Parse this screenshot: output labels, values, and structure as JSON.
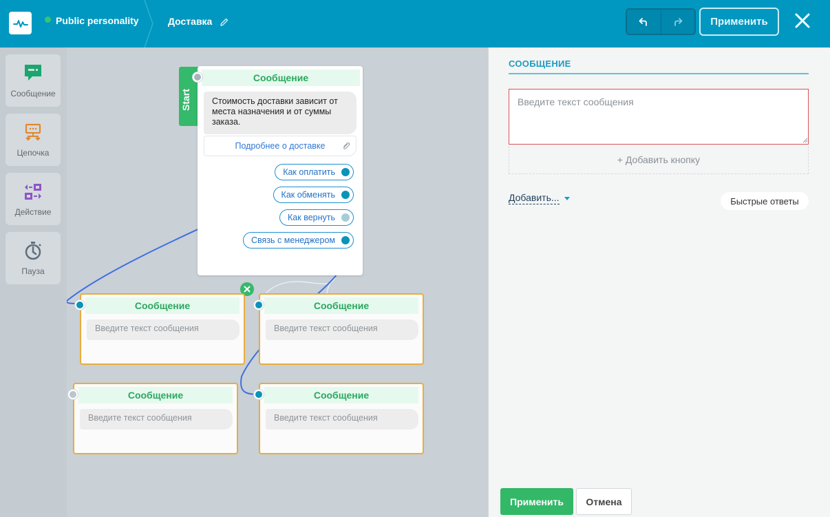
{
  "header": {
    "bot_name": "Public personality",
    "page_name": "Доставка",
    "apply_label": "Применить",
    "icons": {
      "logo": "pulse-logo-icon",
      "edit": "pencil-icon",
      "undo": "undo-icon",
      "redo": "redo-icon",
      "close": "close-icon"
    }
  },
  "toolbar": {
    "items": [
      {
        "label": "Сообщение",
        "icon": "message-icon",
        "color": "#1aa76e"
      },
      {
        "label": "Цепочка",
        "icon": "chain-icon",
        "color": "#e0882f"
      },
      {
        "label": "Действие",
        "icon": "action-icon",
        "color": "#8e54c8"
      },
      {
        "label": "Пауза",
        "icon": "stopwatch-icon",
        "color": "#5e6e7c"
      }
    ]
  },
  "canvas": {
    "start_label": "Start",
    "main_node": {
      "title": "Сообщение",
      "text": "Стоимость доставки зависит от места назначения и от суммы заказа.",
      "link_button": "Подробнее о доставке",
      "quick_replies": [
        "Как оплатить",
        "Как обменять",
        "Как вернуть",
        "Связь с менеджером"
      ]
    },
    "nodes": [
      {
        "title": "Сообщение",
        "placeholder": "Введите текст сообщения"
      },
      {
        "title": "Сообщение",
        "placeholder": "Введите текст сообщения"
      },
      {
        "title": "Сообщение",
        "placeholder": "Введите текст сообщения"
      },
      {
        "title": "Сообщение",
        "placeholder": "Введите текст сообщения"
      }
    ]
  },
  "panel": {
    "title": "СООБЩЕНИЕ",
    "message_placeholder": "Введите текст сообщения",
    "message_value": "",
    "add_button": "+ Добавить кнопку",
    "add_menu": "Добавить...",
    "quick_replies": "Быстрые ответы",
    "apply": "Применить",
    "cancel": "Отмена"
  },
  "colors": {
    "header": "#0098c0",
    "accent_green": "#33b868",
    "node_border": "#e8ad3c",
    "error_border": "#d95358"
  }
}
